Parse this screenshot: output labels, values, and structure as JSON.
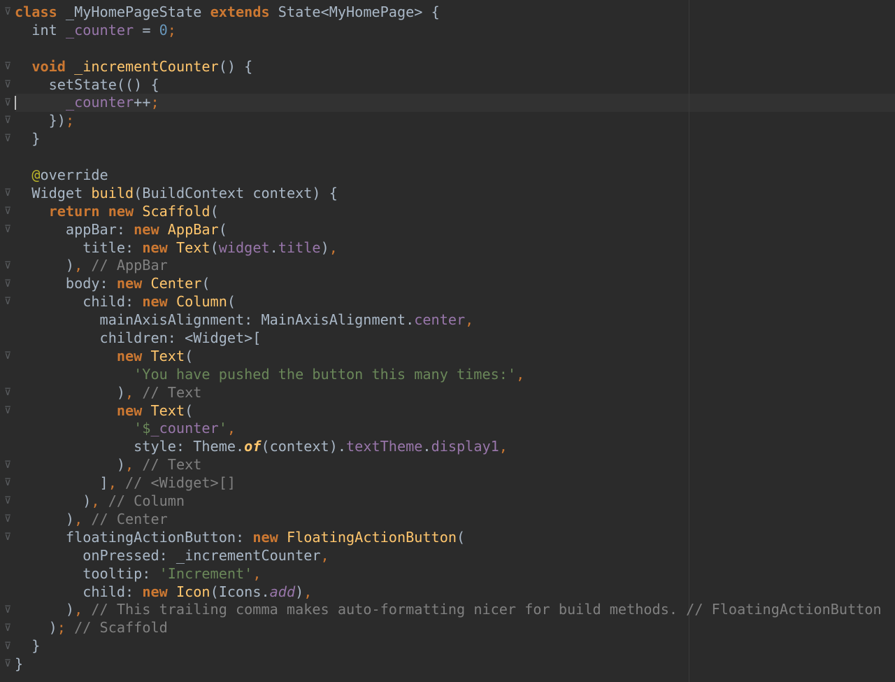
{
  "editor": {
    "fold_marker_glyph": "⊽",
    "lines": [
      [
        [
          "k",
          "class"
        ],
        [
          "t",
          " _MyHomePageState "
        ],
        [
          "k",
          "extends"
        ],
        [
          "t",
          " State<MyHomePage> {"
        ]
      ],
      [
        [
          "t",
          "  int "
        ],
        [
          "m",
          "_counter"
        ],
        [
          "t",
          " = "
        ],
        [
          "n",
          "0"
        ],
        [
          "p",
          ";"
        ]
      ],
      [],
      [
        [
          "t",
          "  "
        ],
        [
          "k",
          "void"
        ],
        [
          "t",
          " "
        ],
        [
          "f",
          "_incrementCounter"
        ],
        [
          "t",
          "() {"
        ]
      ],
      [
        [
          "t",
          "    setState(() {"
        ]
      ],
      [
        [
          "t",
          "      "
        ],
        [
          "m",
          "_counter"
        ],
        [
          "t",
          "++"
        ],
        [
          "p",
          ";"
        ]
      ],
      [
        [
          "t",
          "    })"
        ],
        [
          "p",
          ";"
        ]
      ],
      [
        [
          "t",
          "  }"
        ]
      ],
      [],
      [
        [
          "t",
          "  "
        ],
        [
          "a",
          "@"
        ],
        [
          "t",
          "override"
        ]
      ],
      [
        [
          "t",
          "  Widget "
        ],
        [
          "f",
          "build"
        ],
        [
          "t",
          "(BuildContext context) {"
        ]
      ],
      [
        [
          "t",
          "    "
        ],
        [
          "k",
          "return"
        ],
        [
          "t",
          " "
        ],
        [
          "k",
          "new"
        ],
        [
          "t",
          " "
        ],
        [
          "f",
          "Scaffold"
        ],
        [
          "t",
          "("
        ]
      ],
      [
        [
          "t",
          "      appBar: "
        ],
        [
          "k",
          "new"
        ],
        [
          "t",
          " "
        ],
        [
          "f",
          "AppBar"
        ],
        [
          "t",
          "("
        ]
      ],
      [
        [
          "t",
          "        title: "
        ],
        [
          "k",
          "new"
        ],
        [
          "t",
          " "
        ],
        [
          "f",
          "Text"
        ],
        [
          "t",
          "("
        ],
        [
          "m",
          "widget"
        ],
        [
          "t",
          "."
        ],
        [
          "m",
          "title"
        ],
        [
          "t",
          ")"
        ],
        [
          "p",
          ","
        ]
      ],
      [
        [
          "t",
          "      )"
        ],
        [
          "p",
          ","
        ],
        [
          "c",
          " // AppBar"
        ]
      ],
      [
        [
          "t",
          "      body: "
        ],
        [
          "k",
          "new"
        ],
        [
          "t",
          " "
        ],
        [
          "f",
          "Center"
        ],
        [
          "t",
          "("
        ]
      ],
      [
        [
          "t",
          "        child: "
        ],
        [
          "k",
          "new"
        ],
        [
          "t",
          " "
        ],
        [
          "f",
          "Column"
        ],
        [
          "t",
          "("
        ]
      ],
      [
        [
          "t",
          "          mainAxisAlignment: MainAxisAlignment."
        ],
        [
          "m",
          "center"
        ],
        [
          "p",
          ","
        ]
      ],
      [
        [
          "t",
          "          children: <Widget>["
        ]
      ],
      [
        [
          "t",
          "            "
        ],
        [
          "k",
          "new"
        ],
        [
          "t",
          " "
        ],
        [
          "f",
          "Text"
        ],
        [
          "t",
          "("
        ]
      ],
      [
        [
          "t",
          "              "
        ],
        [
          "s",
          "'You have pushed the button this many times:'"
        ],
        [
          "p",
          ","
        ]
      ],
      [
        [
          "t",
          "            )"
        ],
        [
          "p",
          ","
        ],
        [
          "c",
          " // Text"
        ]
      ],
      [
        [
          "t",
          "            "
        ],
        [
          "k",
          "new"
        ],
        [
          "t",
          " "
        ],
        [
          "f",
          "Text"
        ],
        [
          "t",
          "("
        ]
      ],
      [
        [
          "t",
          "              "
        ],
        [
          "s",
          "'$"
        ],
        [
          "m",
          "_counter"
        ],
        [
          "s",
          "'"
        ],
        [
          "p",
          ","
        ]
      ],
      [
        [
          "t",
          "              style: Theme."
        ],
        [
          "i",
          "of"
        ],
        [
          "t",
          "(context)."
        ],
        [
          "m",
          "textTheme"
        ],
        [
          "t",
          "."
        ],
        [
          "m",
          "display1"
        ],
        [
          "p",
          ","
        ]
      ],
      [
        [
          "t",
          "            )"
        ],
        [
          "p",
          ","
        ],
        [
          "c",
          " // Text"
        ]
      ],
      [
        [
          "t",
          "          ]"
        ],
        [
          "p",
          ","
        ],
        [
          "c",
          " // <Widget>[]"
        ]
      ],
      [
        [
          "t",
          "        )"
        ],
        [
          "p",
          ","
        ],
        [
          "c",
          " // Column"
        ]
      ],
      [
        [
          "t",
          "      )"
        ],
        [
          "p",
          ","
        ],
        [
          "c",
          " // Center"
        ]
      ],
      [
        [
          "t",
          "      floatingActionButton: "
        ],
        [
          "k",
          "new"
        ],
        [
          "t",
          " "
        ],
        [
          "f",
          "FloatingActionButton"
        ],
        [
          "t",
          "("
        ]
      ],
      [
        [
          "t",
          "        onPressed: _incrementCounter"
        ],
        [
          "p",
          ","
        ]
      ],
      [
        [
          "t",
          "        tooltip: "
        ],
        [
          "s",
          "'Increment'"
        ],
        [
          "p",
          ","
        ]
      ],
      [
        [
          "t",
          "        child: "
        ],
        [
          "k",
          "new"
        ],
        [
          "t",
          " "
        ],
        [
          "f",
          "Icon"
        ],
        [
          "t",
          "(Icons."
        ],
        [
          "mi",
          "add"
        ],
        [
          "t",
          ")"
        ],
        [
          "p",
          ","
        ]
      ],
      [
        [
          "t",
          "      )"
        ],
        [
          "p",
          ","
        ],
        [
          "c",
          " // This trailing comma makes auto-formatting nicer for build methods. // FloatingActionButton"
        ]
      ],
      [
        [
          "t",
          "    )"
        ],
        [
          "p",
          ";"
        ],
        [
          "c",
          " // Scaffold"
        ]
      ],
      [
        [
          "t",
          "  }"
        ]
      ],
      [
        [
          "t",
          "}"
        ]
      ]
    ],
    "fold_lines": [
      0,
      3,
      4,
      5,
      6,
      7,
      10,
      11,
      12,
      14,
      15,
      16,
      19,
      21,
      22,
      25,
      26,
      27,
      28,
      29,
      33,
      34,
      35,
      36
    ]
  }
}
